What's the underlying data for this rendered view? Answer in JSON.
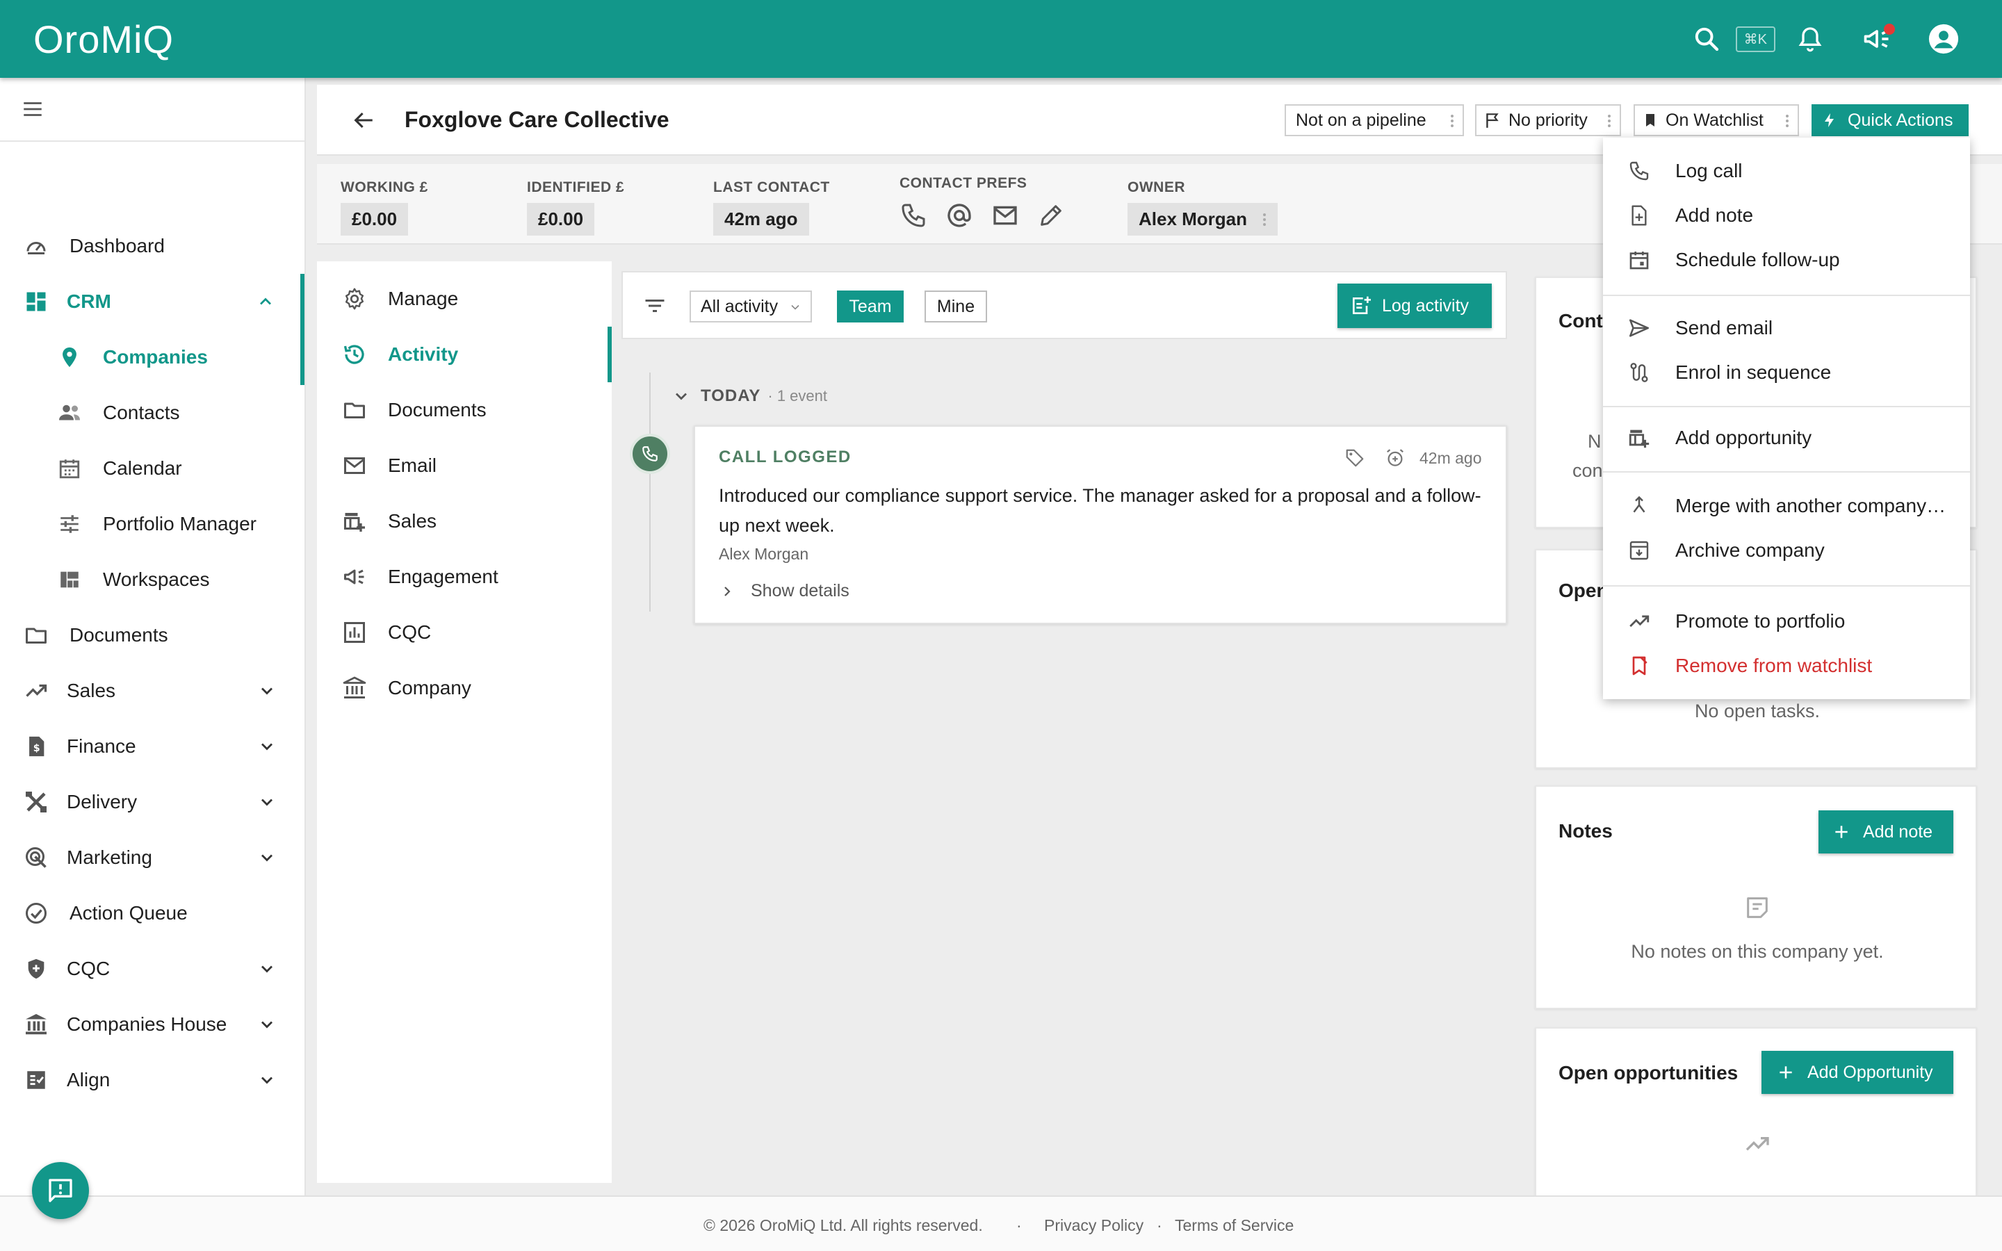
{
  "app": {
    "brand": "OroMiQ",
    "search_shortcut": "⌘K"
  },
  "sidebar": {
    "items": [
      {
        "label": "Dashboard",
        "icon": "dashboard-icon"
      },
      {
        "label": "CRM",
        "icon": "crm-icon",
        "expanded": true
      },
      {
        "label": "Companies",
        "icon": "location-pin-icon",
        "active": true
      },
      {
        "label": "Contacts",
        "icon": "contacts-icon"
      },
      {
        "label": "Calendar",
        "icon": "calendar-icon"
      },
      {
        "label": "Portfolio Manager",
        "icon": "sliders-icon"
      },
      {
        "label": "Workspaces",
        "icon": "workspaces-icon"
      },
      {
        "label": "Documents",
        "icon": "folder-icon"
      },
      {
        "label": "Sales",
        "icon": "trending-icon"
      },
      {
        "label": "Finance",
        "icon": "finance-icon"
      },
      {
        "label": "Delivery",
        "icon": "tools-icon"
      },
      {
        "label": "Marketing",
        "icon": "target-icon"
      },
      {
        "label": "Action Queue",
        "icon": "check-circle-icon"
      },
      {
        "label": "CQC",
        "icon": "shield-icon"
      },
      {
        "label": "Companies House",
        "icon": "bank-icon"
      },
      {
        "label": "Align",
        "icon": "align-icon"
      }
    ]
  },
  "header": {
    "company_name": "Foxglove Care Collective",
    "pipeline_chip": "Not on a pipeline",
    "priority_chip": "No priority",
    "watchlist_chip": "On Watchlist",
    "quick_actions_label": "Quick Actions"
  },
  "stats": {
    "working_label": "WORKING £",
    "working_value": "£0.00",
    "identified_label": "IDENTIFIED £",
    "identified_value": "£0.00",
    "last_contact_label": "LAST CONTACT",
    "last_contact_value": "42m ago",
    "contact_prefs_label": "CONTACT PREFS",
    "owner_label": "OWNER",
    "owner_value": "Alex Morgan"
  },
  "section_nav": {
    "items": [
      {
        "label": "Manage",
        "icon": "gear-icon"
      },
      {
        "label": "Activity",
        "icon": "history-icon",
        "active": true
      },
      {
        "label": "Documents",
        "icon": "folder-icon"
      },
      {
        "label": "Email",
        "icon": "mail-icon"
      },
      {
        "label": "Sales",
        "icon": "sales-icon"
      },
      {
        "label": "Engagement",
        "icon": "megaphone-icon"
      },
      {
        "label": "CQC",
        "icon": "chart-icon"
      },
      {
        "label": "Company",
        "icon": "bank-icon"
      }
    ]
  },
  "activity": {
    "filter_select": "All activity",
    "team_label": "Team",
    "mine_label": "Mine",
    "log_activity_label": "Log activity",
    "group_label": "TODAY",
    "group_count": "· 1 event",
    "event": {
      "type": "CALL LOGGED",
      "time": "42m ago",
      "body": "Introduced our compliance support service. The manager asked for a proposal and a follow-up next week.",
      "author": "Alex Morgan",
      "show_details": "Show details"
    }
  },
  "right_panel": {
    "contacts_title_partial": "Cont",
    "contacts_empty_1": "N",
    "contacts_empty_2": "con",
    "tasks_title_partial": "Open",
    "tasks_empty": "No open tasks.",
    "notes_title": "Notes",
    "add_note_label": "Add note",
    "notes_empty": "No notes on this company yet.",
    "opps_title": "Open opportunities",
    "add_opp_label": "Add Opportunity"
  },
  "quick_actions_menu": {
    "items": [
      {
        "label": "Log call",
        "icon": "phone-icon"
      },
      {
        "label": "Add note",
        "icon": "note-add-icon"
      },
      {
        "label": "Schedule follow-up",
        "icon": "calendar-icon"
      },
      {
        "label": "Send email",
        "icon": "send-icon"
      },
      {
        "label": "Enrol in sequence",
        "icon": "route-icon"
      },
      {
        "label": "Add opportunity",
        "icon": "opportunity-icon"
      },
      {
        "label": "Merge with another company…",
        "icon": "merge-icon"
      },
      {
        "label": "Archive company",
        "icon": "archive-icon"
      },
      {
        "label": "Promote to portfolio",
        "icon": "trending-icon"
      },
      {
        "label": "Remove from watchlist",
        "icon": "bookmark-remove-icon",
        "danger": true
      }
    ]
  },
  "footer": {
    "copyright": "© 2026 OroMiQ Ltd. All rights reserved.",
    "sep": "·",
    "privacy": "Privacy Policy",
    "terms": "Terms of Service"
  },
  "colors": {
    "brand": "#12978a",
    "event_accent": "#4f7f63",
    "danger": "#d32f2f"
  }
}
